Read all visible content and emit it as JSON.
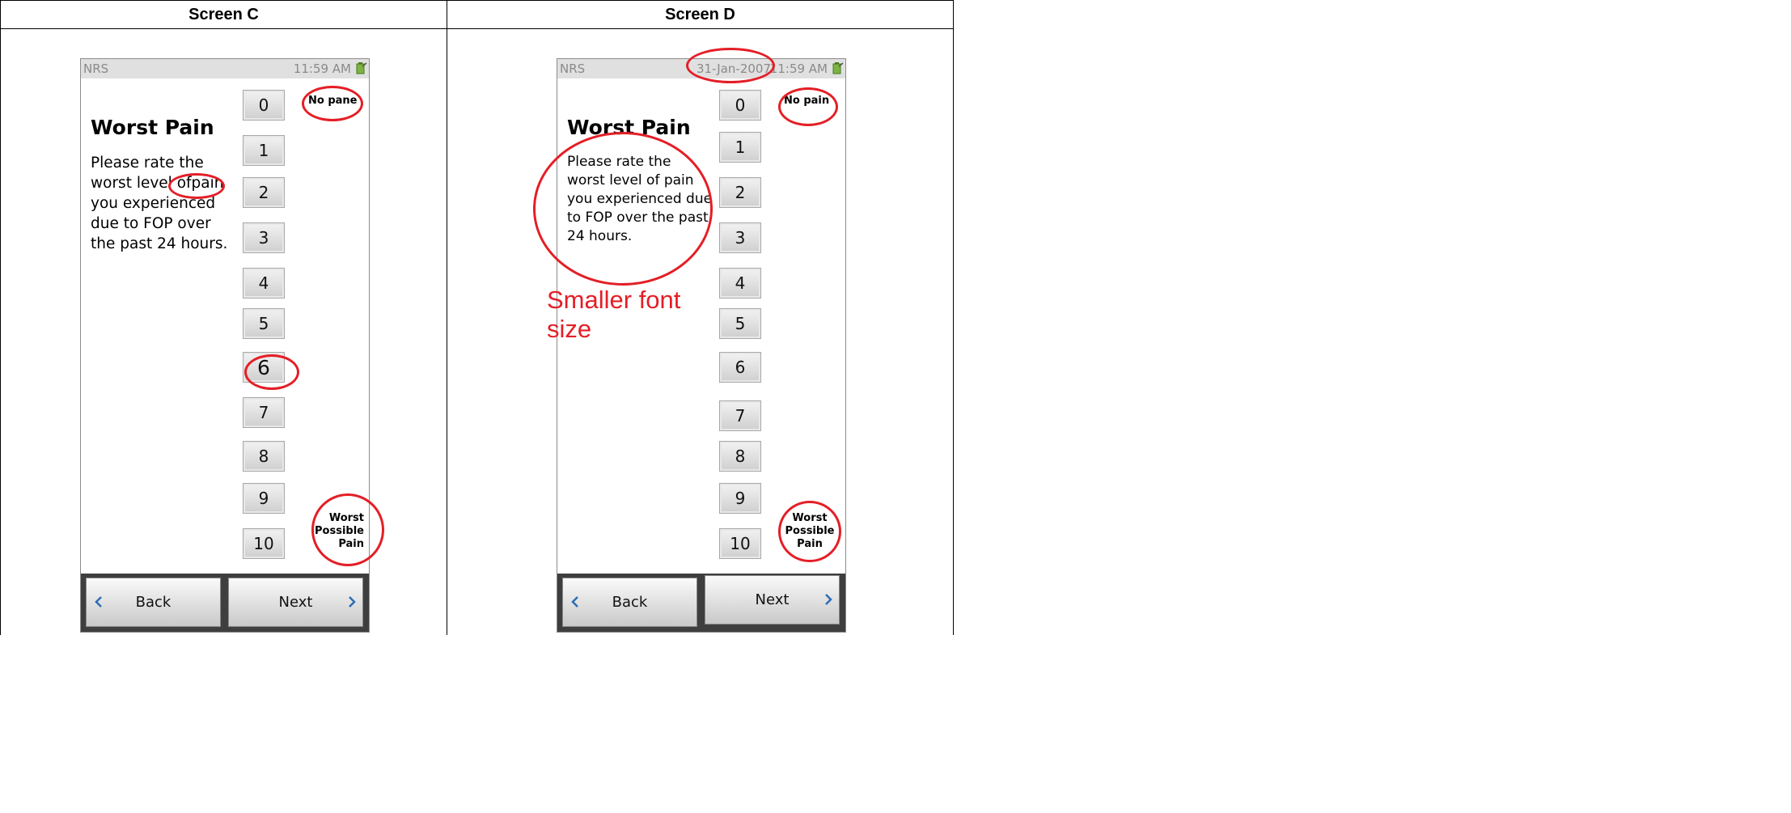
{
  "screens": [
    {
      "heading": "Screen C",
      "app_label": "NRS",
      "date": "",
      "time": "11:59 AM",
      "title": "Worst Pain",
      "prompt": "Please rate the worst level ofpain you experienced due to FOP over the past 24 hours.",
      "scale": [
        "0",
        "1",
        "2",
        "3",
        "4",
        "5",
        "6",
        "7",
        "8",
        "9",
        "10"
      ],
      "low_anchor": "No pane",
      "high_anchor": [
        "Worst",
        "Possible",
        "Pain"
      ],
      "back_label": "Back",
      "next_label": "Next"
    },
    {
      "heading": "Screen D",
      "app_label": "NRS",
      "date": "31-Jan-2007",
      "time": "11:59 AM",
      "title": "Worst Pain",
      "prompt": "Please rate the worst level of pain you experienced due to FOP over the past 24 hours.",
      "scale": [
        "0",
        "1",
        "2",
        "3",
        "4",
        "5",
        "6",
        "7",
        "8",
        "9",
        "10"
      ],
      "low_anchor": "No pain",
      "high_anchor": [
        "Worst",
        "Possible",
        "Pain"
      ],
      "back_label": "Back",
      "next_label": "Next"
    }
  ],
  "annotations": {
    "note": [
      "Smaller font",
      "size"
    ],
    "color": "#e41e26"
  },
  "icons": [
    "battery-icon",
    "chevron-left-icon",
    "chevron-right-icon"
  ]
}
